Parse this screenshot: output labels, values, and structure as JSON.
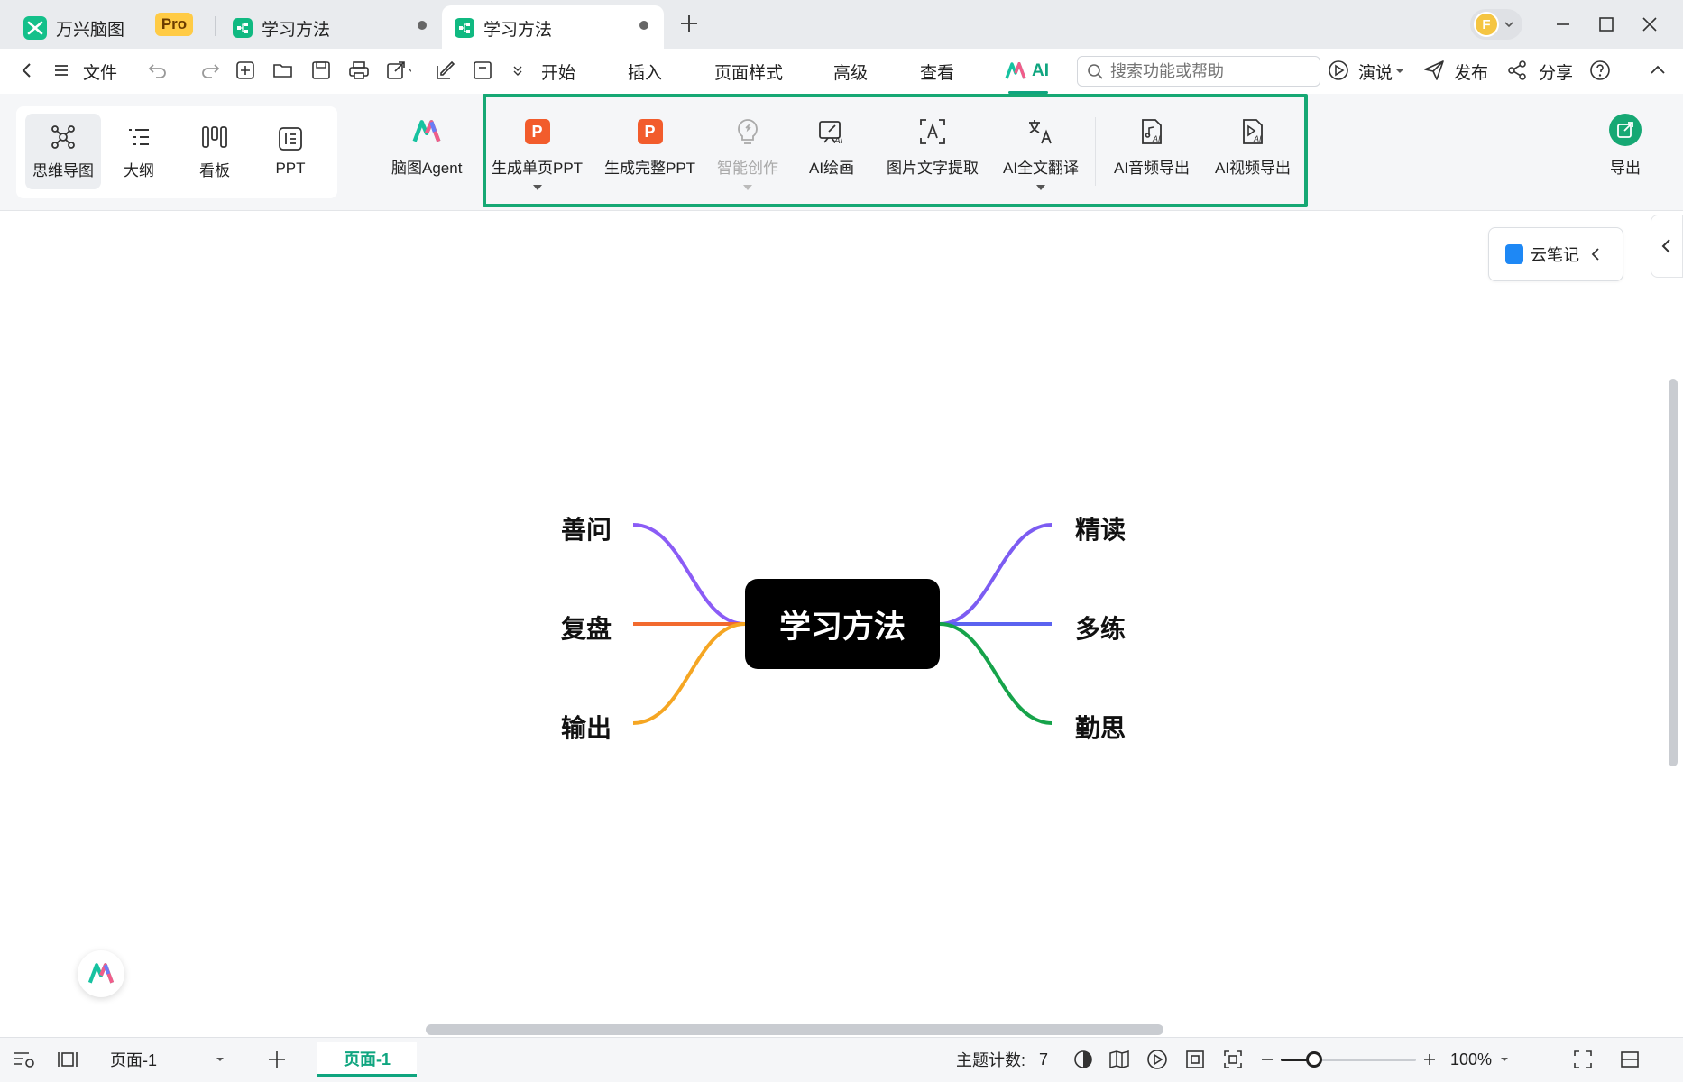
{
  "titlebar": {
    "app_name": "万兴脑图",
    "pro_badge": "Pro",
    "tabs": [
      {
        "label": "学习方法"
      },
      {
        "label": "学习方法"
      }
    ],
    "avatar_initial": "F"
  },
  "menubar": {
    "file": "文件",
    "tabs": [
      {
        "label": "开始"
      },
      {
        "label": "插入"
      },
      {
        "label": "页面样式"
      },
      {
        "label": "高级"
      },
      {
        "label": "查看"
      },
      {
        "label": "AI"
      }
    ],
    "search_placeholder": "搜索功能或帮助",
    "present": "演说",
    "publish": "发布",
    "share": "分享"
  },
  "ribbon": {
    "views": [
      {
        "label": "思维导图",
        "icon": "mindmap-icon"
      },
      {
        "label": "大纲",
        "icon": "outline-icon"
      },
      {
        "label": "看板",
        "icon": "kanban-icon"
      },
      {
        "label": "PPT",
        "icon": "ppt-view-icon"
      }
    ],
    "agent": "脑图Agent",
    "ai_tools": [
      {
        "label": "生成单页PPT"
      },
      {
        "label": "生成完整PPT"
      },
      {
        "label": "智能创作"
      },
      {
        "label": "AI绘画"
      },
      {
        "label": "图片文字提取"
      },
      {
        "label": "AI全文翻译"
      },
      {
        "label": "AI音频导出"
      },
      {
        "label": "AI视频导出"
      }
    ],
    "export": "导出"
  },
  "canvas": {
    "cloud_note": "云笔记",
    "central_topic": "学习方法",
    "left_topics": [
      "善问",
      "复盘",
      "输出"
    ],
    "right_topics": [
      "精读",
      "多练",
      "勤思"
    ],
    "branch_colors": {
      "善问": "#8b5cf6",
      "复盘": "#f26a2e",
      "输出": "#f5a623",
      "精读": "#7c5cf2",
      "多练": "#5b63f0",
      "勤思": "#16a34a"
    }
  },
  "statusbar": {
    "page_select": "页面-1",
    "page_tab": "页面-1",
    "topic_count_label": "主题计数:",
    "topic_count": "7",
    "zoom": "100%",
    "zoom_level": 0.25
  },
  "colors": {
    "accent": "#16a874",
    "ppt": "#f25c2c"
  }
}
